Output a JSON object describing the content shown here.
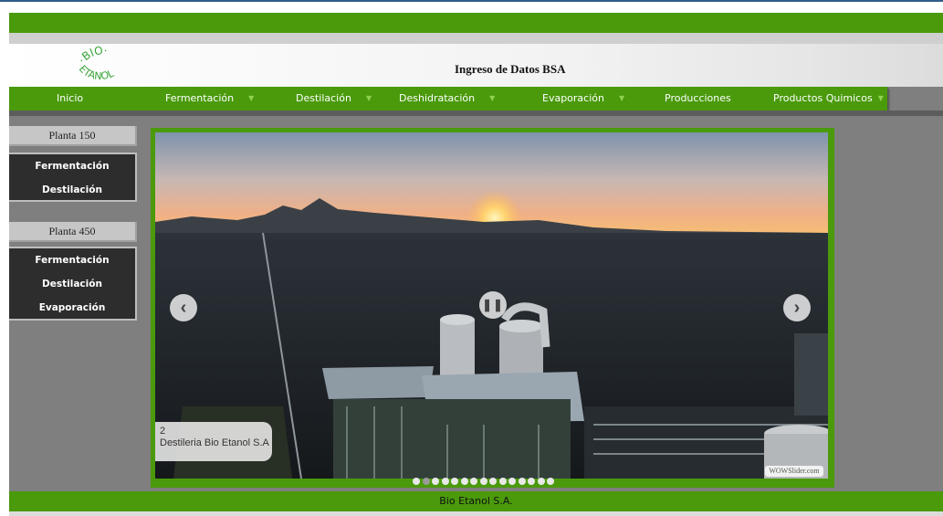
{
  "header": {
    "logo_text": "BIO ETANOL",
    "title": "Ingreso de Datos BSA"
  },
  "nav": {
    "items": [
      {
        "label": "Inicio",
        "has_dropdown": false
      },
      {
        "label": "Fermentación",
        "has_dropdown": true
      },
      {
        "label": "Destilación",
        "has_dropdown": true
      },
      {
        "label": "Deshidratación",
        "has_dropdown": true
      },
      {
        "label": "Evaporación",
        "has_dropdown": true
      },
      {
        "label": "Producciones",
        "has_dropdown": false
      },
      {
        "label": "Productos Quimicos",
        "has_dropdown": true
      }
    ],
    "caret_icon": "caret-down-icon"
  },
  "sidebar": {
    "groups": [
      {
        "heading": "Planta 150",
        "links": [
          "Fermentación",
          "Destilación"
        ]
      },
      {
        "heading": "Planta 450",
        "links": [
          "Fermentación",
          "Destilación",
          "Evaporación"
        ]
      }
    ]
  },
  "slider": {
    "caption_number": "2",
    "caption_text": "Destileria Bio Etanol S.A",
    "watermark": "WOWSlider.com",
    "prev_icon": "chevron-left-icon",
    "next_icon": "chevron-right-icon",
    "pause_icon": "pause-icon",
    "bullet_count": 15,
    "active_bullet": 2
  },
  "footer": {
    "text": "Bio Etanol S.A."
  },
  "colors": {
    "green": "#4a9a0c",
    "page_gray": "#7f7f7f",
    "sidebar_dark": "#2d2d2d"
  }
}
